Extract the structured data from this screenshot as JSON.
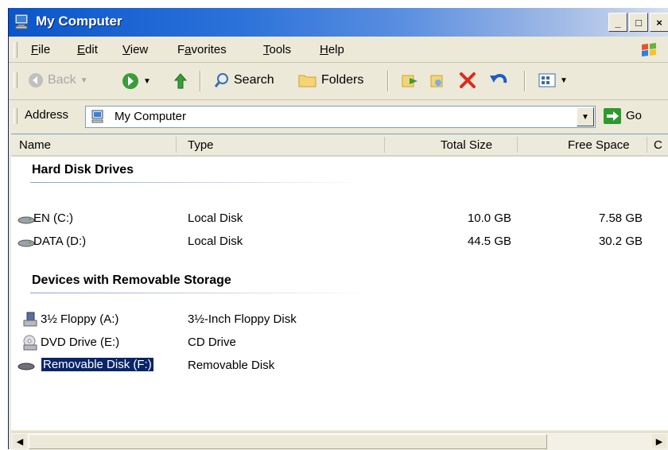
{
  "window": {
    "title": "My Computer",
    "btn_min": "_",
    "btn_max": "□",
    "btn_close": "×"
  },
  "menu": [
    {
      "label": "File",
      "accel": "F",
      "rest": "ile"
    },
    {
      "label": "Edit",
      "accel": "E",
      "rest": "dit"
    },
    {
      "label": "View",
      "accel": "V",
      "rest": "iew"
    },
    {
      "label": "Favorites",
      "pre": "F",
      "accel": "a",
      "rest": "vorites"
    },
    {
      "label": "Tools",
      "accel": "T",
      "rest": "ools"
    },
    {
      "label": "Help",
      "accel": "H",
      "rest": "elp"
    }
  ],
  "toolbar": {
    "back": "Back",
    "search": "Search",
    "folders": "Folders"
  },
  "address": {
    "label": "Address",
    "value": "My Computer",
    "go": "Go"
  },
  "columns": [
    "Name",
    "Type",
    "Total Size",
    "Free Space",
    "C"
  ],
  "groups": {
    "hard_disks": {
      "title": "Hard Disk Drives",
      "items": [
        {
          "name": "EN (C:)",
          "type": "Local Disk",
          "total": "10.0 GB",
          "free": "7.58 GB"
        },
        {
          "name": "DATA (D:)",
          "type": "Local Disk",
          "total": "44.5 GB",
          "free": "30.2 GB"
        }
      ]
    },
    "removable": {
      "title": "Devices with Removable Storage",
      "items": [
        {
          "name": "3½ Floppy (A:)",
          "type": "3½-Inch Floppy Disk"
        },
        {
          "name": "DVD Drive (E:)",
          "type": "CD Drive"
        },
        {
          "name": "Removable Disk (F:)",
          "type": "Removable Disk",
          "selected": true
        }
      ]
    }
  },
  "colors": {
    "title_start": "#0a55c9",
    "selection": "#0a246a",
    "face": "#ece9d8"
  }
}
